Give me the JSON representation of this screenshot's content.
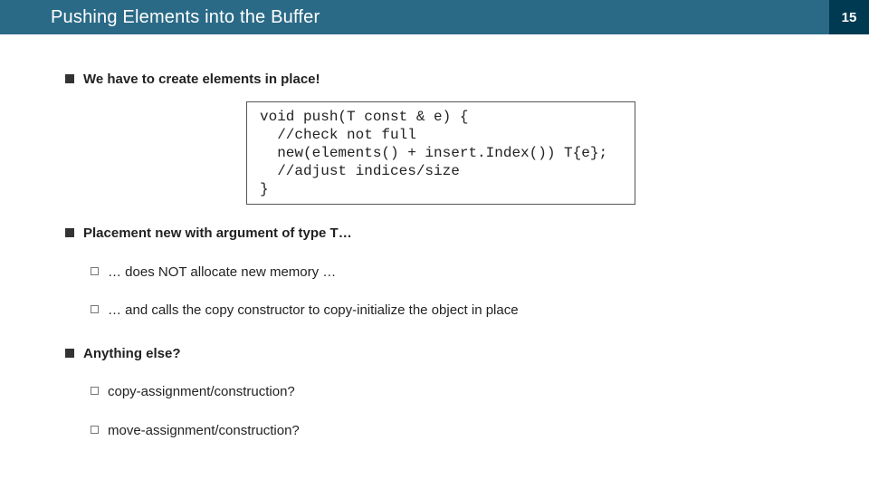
{
  "header": {
    "title": "Pushing Elements into the Buffer",
    "slide_number": "15"
  },
  "bullets": {
    "b1": "We have to create elements in place!",
    "b2": "Placement new with argument of type T…",
    "b2a": "… does NOT allocate new memory …",
    "b2b": "… and calls the copy constructor to copy-initialize the object in place",
    "b3": "Anything else?",
    "b3a": "copy-assignment/construction?",
    "b3b": "move-assignment/construction?"
  },
  "code": "void push(T const & e) {\n  //check not full\n  new(elements() + insert.Index()) T{e};\n  //adjust indices/size\n}"
}
